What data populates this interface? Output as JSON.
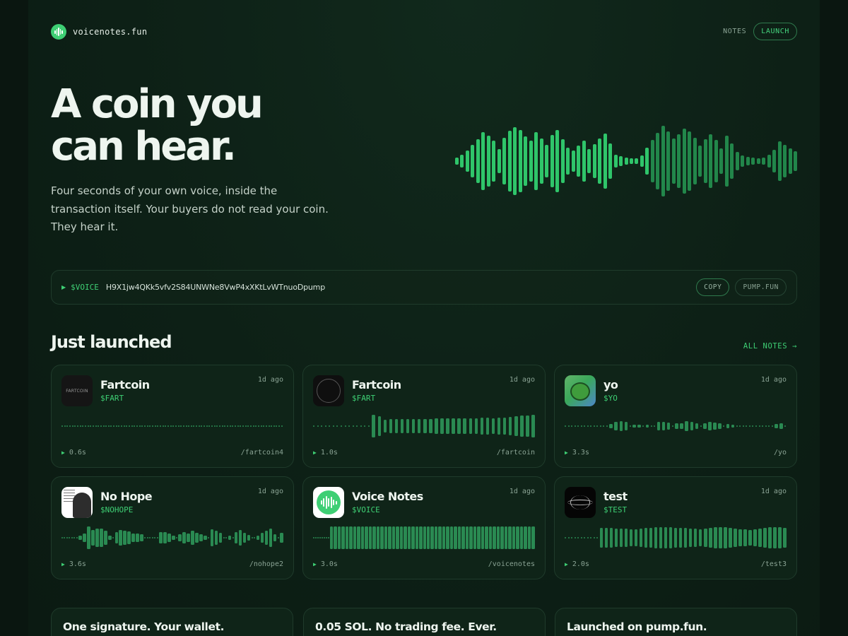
{
  "header": {
    "logo_text": "voicenotes.fun",
    "nav_notes": "NOTES",
    "nav_launch": "LAUNCH"
  },
  "hero": {
    "title_line1": "A coin you",
    "title_line2": "can hear.",
    "subtitle": "Four seconds of your own voice, inside the transaction itself. Your buyers do not read your coin. They hear it.",
    "waveform": [
      10,
      18,
      30,
      46,
      62,
      82,
      72,
      58,
      34,
      66,
      86,
      96,
      88,
      70,
      58,
      82,
      64,
      46,
      74,
      88,
      62,
      38,
      30,
      44,
      58,
      34,
      48,
      64,
      78,
      50,
      18,
      14,
      10,
      8,
      8,
      16,
      38,
      60,
      80,
      100,
      84,
      64,
      76,
      92,
      84,
      66,
      44,
      62,
      76,
      60,
      36,
      72,
      50,
      26,
      16,
      12,
      10,
      8,
      10,
      18,
      32,
      56,
      46,
      36,
      28
    ]
  },
  "contract": {
    "symbol": "$VOICE",
    "address": "H9X1jw4QKk5vfv2S84UNWNe8VwP4xXKtLvWTnuoDpump",
    "copy_label": "COPY",
    "pump_label": "PUMP.FUN"
  },
  "section": {
    "title": "Just launched",
    "all_link": "ALL NOTES →"
  },
  "cards": [
    {
      "name": "Fartcoin",
      "ticker": "$FART",
      "time": "1d ago",
      "duration": "0.6s",
      "slug": "/fartcoin4",
      "avatar_text": "FARTCOIN",
      "wave": [
        0,
        0,
        0,
        0,
        0,
        0,
        0,
        0,
        0,
        0,
        0,
        0,
        0,
        0,
        0,
        0,
        0,
        0,
        0,
        0,
        0,
        0,
        0,
        0,
        0,
        0,
        0,
        0,
        0,
        0,
        0,
        0,
        0,
        0,
        0,
        0,
        0,
        0,
        0,
        0,
        0,
        0,
        0,
        0,
        0,
        0,
        0,
        0,
        0,
        0,
        0,
        0,
        0,
        0,
        0,
        0,
        0,
        0,
        0,
        0,
        0,
        0,
        0,
        0,
        0,
        0,
        0,
        0,
        0,
        0,
        0,
        0,
        0,
        0,
        0,
        0,
        0,
        0,
        0,
        0,
        0,
        0,
        0,
        0,
        0,
        0
      ]
    },
    {
      "name": "Fartcoin",
      "ticker": "$FART",
      "time": "1d ago",
      "duration": "1.0s",
      "slug": "/fartcoin",
      "wave": [
        0,
        0,
        0,
        0,
        0,
        0,
        0,
        0,
        0,
        0,
        0,
        0,
        0,
        0,
        0,
        100,
        90,
        58,
        60,
        60,
        62,
        62,
        62,
        64,
        64,
        64,
        66,
        66,
        66,
        68,
        68,
        70,
        70,
        70,
        72,
        72,
        70,
        72,
        74,
        80,
        88,
        92,
        96,
        100
      ]
    },
    {
      "name": "yo",
      "ticker": "$YO",
      "time": "1d ago",
      "duration": "3.3s",
      "slug": "/yo",
      "wave": [
        0,
        0,
        0,
        0,
        0,
        0,
        0,
        0,
        0,
        0,
        0,
        0,
        0,
        0,
        18,
        40,
        46,
        36,
        0,
        12,
        10,
        0,
        14,
        0,
        0,
        36,
        40,
        30,
        0,
        22,
        28,
        42,
        40,
        28,
        0,
        24,
        36,
        30,
        22,
        0,
        18,
        12,
        0,
        0,
        0,
        0,
        0,
        0,
        0,
        0,
        0,
        0,
        0,
        0,
        18,
        24,
        0
      ]
    },
    {
      "name": "No Hope",
      "ticker": "$NOHOPE",
      "time": "1d ago",
      "duration": "3.6s",
      "slug": "/nohope2",
      "wave": [
        0,
        0,
        0,
        0,
        0,
        0,
        0,
        18,
        40,
        100,
        70,
        84,
        80,
        60,
        18,
        0,
        52,
        66,
        62,
        56,
        40,
        40,
        34,
        0,
        0,
        0,
        0,
        0,
        0,
        52,
        50,
        40,
        18,
        0,
        30,
        48,
        38,
        60,
        46,
        32,
        20,
        0,
        74,
        60,
        42,
        0,
        0,
        18,
        0,
        50,
        66,
        44,
        28,
        0,
        0,
        18,
        46,
        62,
        80,
        32,
        0,
        44
      ]
    },
    {
      "name": "Voice Notes",
      "ticker": "$VOICE",
      "time": "1d ago",
      "duration": "3.0s",
      "slug": "/voicenotes",
      "wave": [
        0,
        0,
        0,
        0,
        0,
        0,
        0,
        0,
        100,
        100,
        100,
        100,
        100,
        100,
        100,
        100,
        100,
        100,
        100,
        100,
        100,
        100,
        100,
        100,
        100,
        100,
        100,
        100,
        100,
        100,
        100,
        100,
        100,
        100,
        100,
        100,
        100,
        100,
        100,
        100,
        100,
        100,
        100,
        100,
        100,
        100,
        100,
        100,
        100,
        100,
        100,
        100,
        100,
        100,
        100,
        100,
        100,
        100,
        100,
        100,
        100
      ]
    },
    {
      "name": "test",
      "ticker": "$TEST",
      "time": "1d ago",
      "duration": "2.0s",
      "slug": "/test3",
      "wave": [
        0,
        0,
        0,
        0,
        0,
        0,
        0,
        0,
        0,
        0,
        0,
        90,
        90,
        86,
        84,
        80,
        80,
        76,
        78,
        80,
        86,
        90,
        92,
        94,
        96,
        92,
        88,
        90,
        86,
        82,
        80,
        78,
        82,
        88,
        92,
        96,
        92,
        86,
        82,
        78,
        74,
        70,
        74,
        82,
        90,
        92,
        96,
        94,
        90
      ]
    }
  ],
  "features": [
    {
      "title": "One signature. Your wallet."
    },
    {
      "title": "0.05 SOL. No trading fee. Ever."
    },
    {
      "title": "Launched on pump.fun."
    }
  ],
  "colors": {
    "accent": "#3ecf74",
    "background": "#0a1610",
    "card": "#0f2418",
    "border": "#1f3b2b"
  },
  "icons": {
    "logo": "waveform-icon",
    "play": "play-icon",
    "arrow": "arrow-right-icon"
  }
}
